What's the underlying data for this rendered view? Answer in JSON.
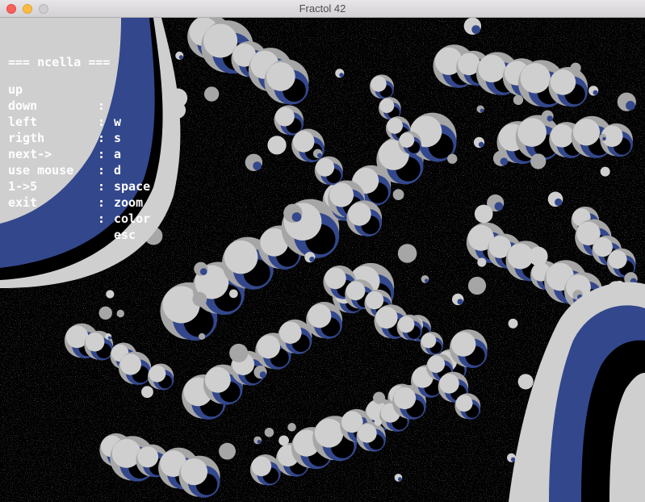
{
  "window": {
    "title": "Fractol 42"
  },
  "colors": {
    "palette_light": "#cfcfcf",
    "palette_mid": "#a6a6a6",
    "palette_blue": "#33478c",
    "background": "#000000"
  },
  "menu": {
    "heading": "=== ncella ===",
    "items": [
      {
        "key": "up",
        "action": "w"
      },
      {
        "key": "down",
        "action": "s"
      },
      {
        "key": "left",
        "action": "a"
      },
      {
        "key": "rigth",
        "action": "d"
      },
      {
        "key": "next->",
        "action": "space"
      },
      {
        "key": "use mouse",
        "action": "zoom"
      },
      {
        "key": "1->5",
        "action": "color"
      },
      {
        "key": "exit",
        "action": "esc"
      }
    ],
    "separator": ":"
  }
}
